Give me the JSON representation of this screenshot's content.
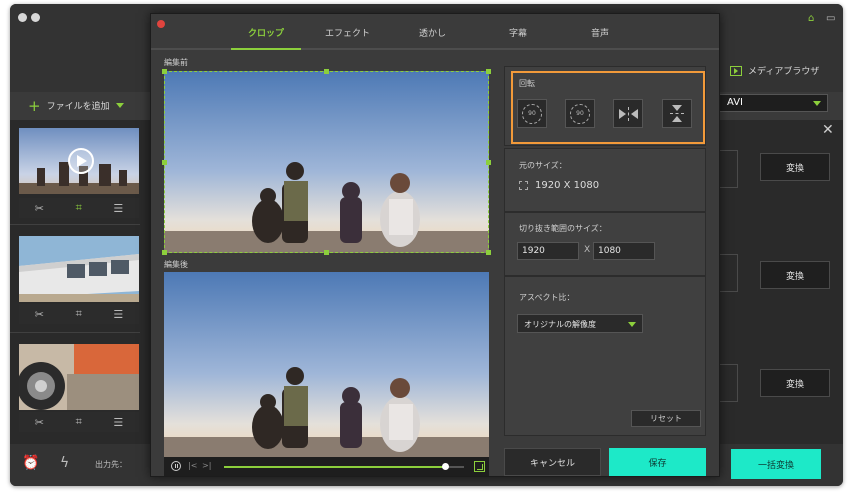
{
  "app": {
    "add_file_label": "ファイルを追加",
    "media_browser_label": "メディアブラウザ",
    "format_value": "AVI",
    "convert_label": "変換",
    "output_label": "出力先：",
    "bulk_convert_label": "一括変換",
    "icons": [
      "plus-icon",
      "gift-icon",
      "chat-icon",
      "close-icon",
      "scissors-icon",
      "crop-icon",
      "sliders-icon",
      "alarm-icon",
      "bolt-icon",
      "media-browser-icon"
    ]
  },
  "dialog": {
    "tabs": [
      {
        "label": "クロップ",
        "active": true
      },
      {
        "label": "エフェクト",
        "active": false
      },
      {
        "label": "透かし",
        "active": false
      },
      {
        "label": "字幕",
        "active": false
      },
      {
        "label": "音声",
        "active": false
      }
    ],
    "before_label": "編集前",
    "after_label": "編集後",
    "rotate": {
      "title": "回転",
      "ccw_label": "90",
      "cw_label": "90"
    },
    "original_size": {
      "title": "元のサイズ：",
      "value": "1920 X 1080"
    },
    "crop_size": {
      "title": "切り抜き範囲のサイズ：",
      "width": "1920",
      "separator": "X",
      "height": "1080"
    },
    "aspect": {
      "title": "アスペクト比：",
      "value": "オリジナルの解像度"
    },
    "reset_label": "リセット",
    "cancel_label": "キャンセル",
    "save_label": "保存",
    "playback_progress": 0.92
  },
  "colors": {
    "accent_green": "#8ccf3c",
    "highlight_orange": "#f29a3a",
    "button_teal": "#1de9c8"
  }
}
